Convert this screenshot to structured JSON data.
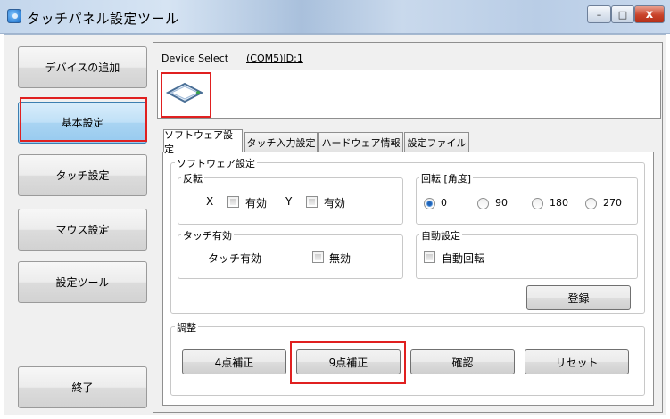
{
  "window": {
    "title": "タッチパネル設定ツール",
    "minimize_symbol": "–",
    "maximize_symbol": "□",
    "close_symbol": "x"
  },
  "nav": {
    "add_device": "デバイスの追加",
    "basic_settings": "基本設定",
    "touch_settings": "タッチ設定",
    "mouse_settings": "マウス設定",
    "settings_tool": "設定ツール",
    "exit": "終了",
    "active": "basic_settings"
  },
  "device": {
    "label": "Device Select",
    "selected": "(COM5)ID:1",
    "icon": "touch-panel-icon"
  },
  "tabs": {
    "software": "ソフトウェア設定",
    "touch_input": "タッチ入力設定",
    "hardware_info": "ハードウェア情報",
    "settings_file": "設定ファイル",
    "active": "software"
  },
  "software": {
    "group_title": "ソフトウェア設定",
    "invert": {
      "title": "反転",
      "x_label": "X",
      "x_enable": "有効",
      "y_label": "Y",
      "y_enable": "有効"
    },
    "rotation": {
      "title": "回転 [角度]",
      "options": [
        "0",
        "90",
        "180",
        "270"
      ],
      "selected": "0"
    },
    "touch_enable": {
      "title": "タッチ有効",
      "label": "タッチ有効",
      "disable": "無効"
    },
    "auto": {
      "title": "自動設定",
      "auto_rotate": "自動回転"
    },
    "register_button": "登録"
  },
  "calibration": {
    "title": "調整",
    "four_point": "4点補正",
    "nine_point": "9点補正",
    "confirm": "確認",
    "reset": "リセット"
  },
  "colors": {
    "highlight": "#e02020",
    "active_nav": "#a9d4f2",
    "radio_selected": "#1f63b8"
  }
}
